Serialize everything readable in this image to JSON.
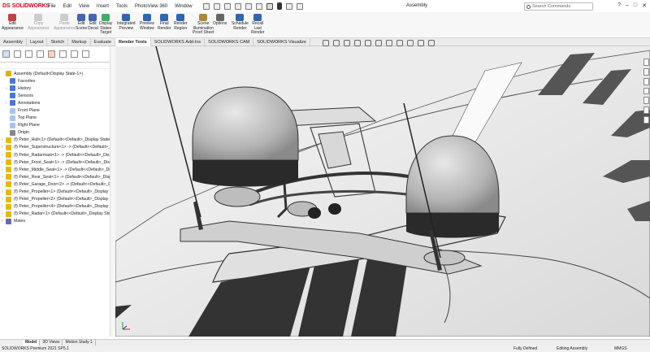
{
  "app": {
    "logo_prefix": "DS",
    "logo_text": "SOLIDWORKS",
    "window_title": "Assembly"
  },
  "menu": [
    "File",
    "Edit",
    "View",
    "Insert",
    "Tools",
    "PhotoView 360",
    "Window"
  ],
  "search": {
    "placeholder": "Search Commands"
  },
  "ribbon": {
    "buttons": [
      {
        "label": "Edit\nAppearance",
        "enabled": true
      },
      {
        "label": "Copy\nAppearance",
        "enabled": false
      },
      {
        "label": "Paste\nAppearance",
        "enabled": false
      },
      {
        "label": "Edit\nScene",
        "enabled": true
      },
      {
        "label": "Edit\nDecal",
        "enabled": true
      },
      {
        "label": "Display\nStates\nTarget",
        "enabled": true
      },
      {
        "label": "Integrated\nPreview",
        "enabled": true
      },
      {
        "label": "Preview\nWindow",
        "enabled": true
      },
      {
        "label": "Final\nRender",
        "enabled": true
      },
      {
        "label": "Render\nRegion",
        "enabled": true
      },
      {
        "label": "Scene\nIllumination\nProof Sheet",
        "enabled": true
      },
      {
        "label": "Options",
        "enabled": true
      },
      {
        "label": "Schedule\nRender",
        "enabled": true
      },
      {
        "label": "Recall\nLast\nRender",
        "enabled": true
      }
    ]
  },
  "tabs": [
    "Assembly",
    "Layout",
    "Sketch",
    "Markup",
    "Evaluate",
    "Render Tools",
    "SOLIDWORKS Add-Ins",
    "SOLIDWORKS CAM",
    "SOLIDWORKS Visualize"
  ],
  "active_tab": "Render Tools",
  "tree": {
    "items": [
      {
        "label": "Assembly  (Default<Display State-1>)",
        "icon": "assembly-icon",
        "expand": false
      },
      {
        "label": "Favorites",
        "icon": "favorites-icon",
        "expand": false
      },
      {
        "label": "History",
        "icon": "history-icon",
        "expand": true
      },
      {
        "label": "Sensors",
        "icon": "sensor-icon",
        "expand": false
      },
      {
        "label": "Annotations",
        "icon": "annotation-icon",
        "expand": true
      },
      {
        "label": "Front Plane",
        "icon": "plane-icon",
        "expand": false
      },
      {
        "label": "Top Plane",
        "icon": "plane-icon",
        "expand": false
      },
      {
        "label": "Right Plane",
        "icon": "plane-icon",
        "expand": false
      },
      {
        "label": "Origin",
        "icon": "origin-icon",
        "expand": false
      },
      {
        "label": "(f) Peter_Hull<1> (Default<<Default>_Display State 1>",
        "icon": "part-icon",
        "expand": true
      },
      {
        "label": "(f) Peter_Superstructure<1> -> (Default<<Default>_Di",
        "icon": "part-icon",
        "expand": true
      },
      {
        "label": "(f) Peter_Radarmast<1> -> (Default<<Default>_Display",
        "icon": "part-icon",
        "expand": true
      },
      {
        "label": "(f) Peter_Front_Seat<1> -> (Default<<Default>_Displa",
        "icon": "part-icon",
        "expand": true
      },
      {
        "label": "(f) Peter_Middle_Seat<1> -> (Default<<Default>_Displ",
        "icon": "part-icon",
        "expand": true
      },
      {
        "label": "(f) Peter_Rear_Seat<1> -> (Default<<Default>_Display",
        "icon": "part-icon",
        "expand": true
      },
      {
        "label": "(f) Peter_Garage_Door<2> -> (Default<<Default>_Dis",
        "icon": "part-icon",
        "expand": true
      },
      {
        "label": "(f) Peter_Propeller<1> (Default<<Default>_Display Sta",
        "icon": "part-icon",
        "expand": true
      },
      {
        "label": "(f) Peter_Propeller<2> (Default<<Default>_Display Sta",
        "icon": "part-icon",
        "expand": true
      },
      {
        "label": "(f) Peter_Propeller<4> (Default<<Default>_Display Sta",
        "icon": "part-icon",
        "expand": true
      },
      {
        "label": "(f) Peter_Radar<1> (Default<<Default>_Display State 1",
        "icon": "part-icon",
        "expand": true
      },
      {
        "label": "Mates",
        "icon": "mates-icon",
        "expand": true
      }
    ]
  },
  "bottom_tabs": [
    "Model",
    "3D Views",
    "Motion Study 1"
  ],
  "active_bottom_tab": "Model",
  "status": {
    "left": "SOLIDWORKS Premium 2021 SP5.1",
    "state": "Fully Defined",
    "mode": "Editing Assembly",
    "units": "MMGS"
  },
  "colors": {
    "brand": "#d6001c",
    "accent": "#1a63c6",
    "part": "#e8b800"
  }
}
